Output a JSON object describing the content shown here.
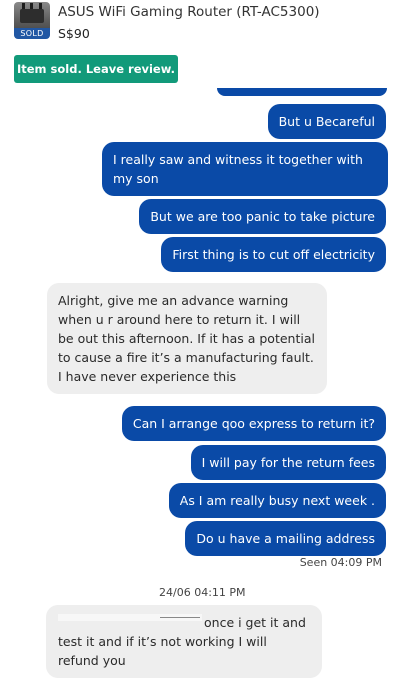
{
  "listing": {
    "title": "ASUS WiFi Gaming Router (RT-AC5300)",
    "price": "S$90",
    "status_tag": "SOLD",
    "review_button": "Item sold. Leave review."
  },
  "messages": [
    {
      "side": "out",
      "text": "But u Becareful"
    },
    {
      "side": "out",
      "text": "I really saw and witness it together with my son"
    },
    {
      "side": "out",
      "text": "But we are too panic to take picture"
    },
    {
      "side": "out",
      "text": "First thing is to cut off electricity"
    },
    {
      "side": "in",
      "text": "Alright, give me an advance warning when u r around here to return it. I will be out this afternoon. If it has a potential to cause a fire it’s a manufacturing fault. I have never experience this"
    },
    {
      "side": "out",
      "text": "Can I arrange qoo express to return it?"
    },
    {
      "side": "out",
      "text": "I will pay for the return fees"
    },
    {
      "side": "out",
      "text": "As I am really busy next week ."
    },
    {
      "side": "out",
      "text": "Do u have a mailing address"
    },
    {
      "side": "in",
      "text": "once i get it and test it and if it’s not working I will refund you"
    }
  ],
  "seen_status": "Seen 04:09 PM",
  "date_divider": "24/06 04:11 PM",
  "colors": {
    "outgoing_bubble": "#0a4aa7",
    "incoming_bubble": "#eeeeee",
    "review_button": "#129a7a",
    "sold_tag": "#2157a4"
  }
}
